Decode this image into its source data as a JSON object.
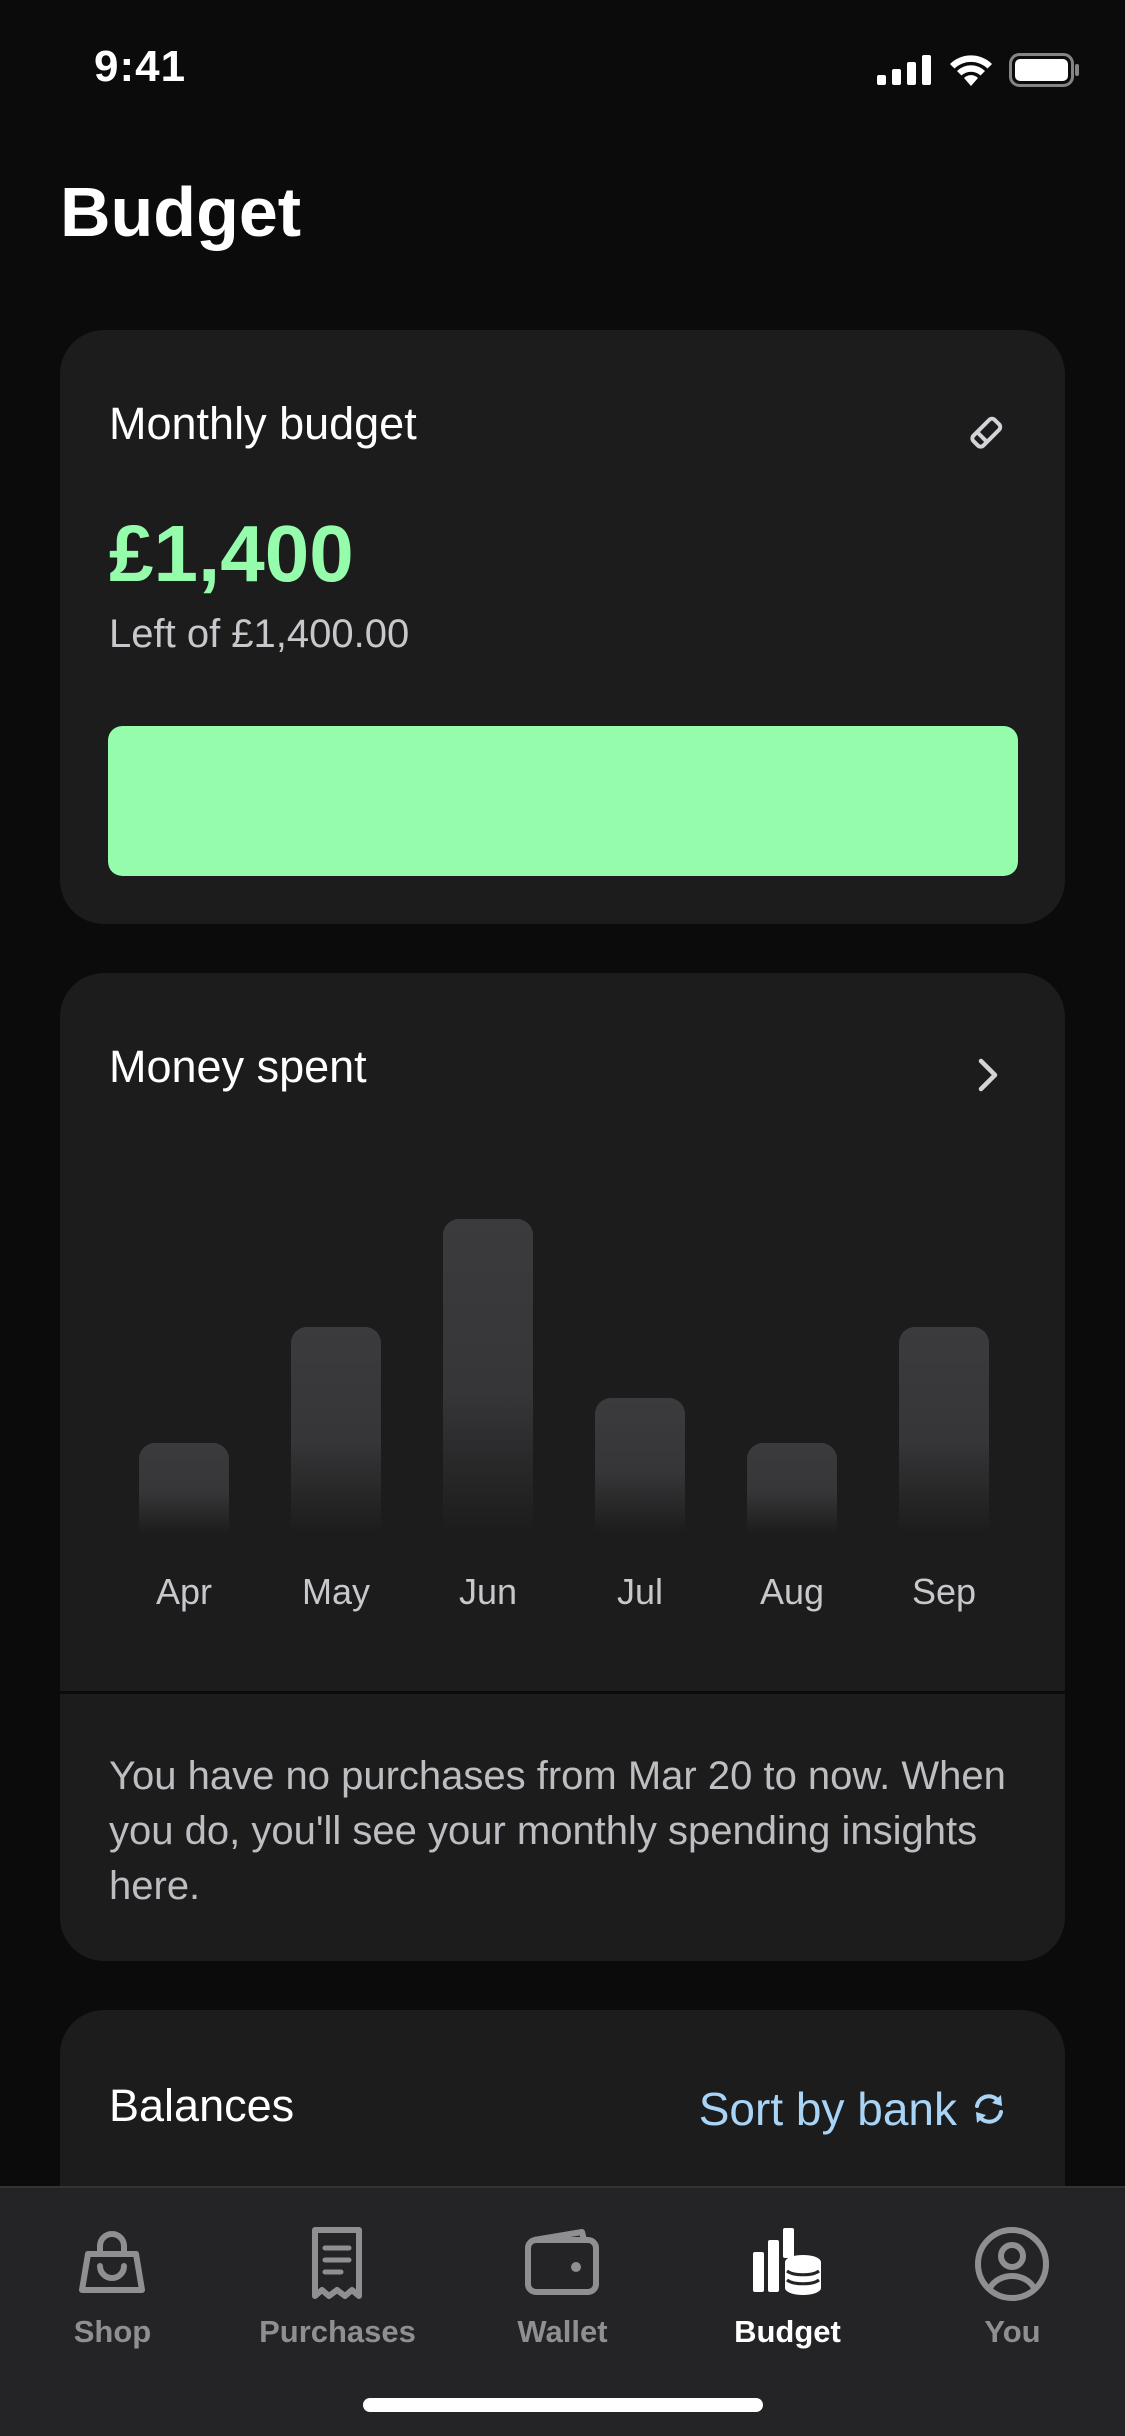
{
  "status": {
    "time": "9:41",
    "icons": [
      "signal-icon",
      "wifi-icon",
      "battery-icon"
    ]
  },
  "page": {
    "title": "Budget"
  },
  "budget_card": {
    "title": "Monthly budget",
    "amount": "£1,400",
    "left_text": "Left of £1,400.00",
    "remaining_fraction": 1.0,
    "accent_color": "#95fcac",
    "edit_icon": "pencil-icon"
  },
  "spent_card": {
    "title": "Money spent",
    "chevron_icon": "chevron-right-icon",
    "info_text": "You have no purchases from Mar 20 to now. When you do, you'll see your monthly spending insights here."
  },
  "chart_data": {
    "type": "bar",
    "categories": [
      "Apr",
      "May",
      "Jun",
      "Jul",
      "Aug",
      "Sep"
    ],
    "values": [
      1.0,
      2.3,
      3.5,
      1.5,
      1.0,
      2.3
    ],
    "title": "",
    "xlabel": "",
    "ylabel": "",
    "ylim": [
      0,
      3.5
    ],
    "grid": false
  },
  "balances_card": {
    "title": "Balances",
    "sort_label": "Sort by bank",
    "sort_icon": "sync-icon",
    "accent_color": "#a9d4f5"
  },
  "tabbar": {
    "tabs": [
      {
        "label": "Shop",
        "icon": "shopping-bag-icon",
        "active": false
      },
      {
        "label": "Purchases",
        "icon": "receipt-icon",
        "active": false
      },
      {
        "label": "Wallet",
        "icon": "wallet-icon",
        "active": false
      },
      {
        "label": "Budget",
        "icon": "budget-chart-icon",
        "active": true
      },
      {
        "label": "You",
        "icon": "profile-icon",
        "active": false
      }
    ]
  }
}
